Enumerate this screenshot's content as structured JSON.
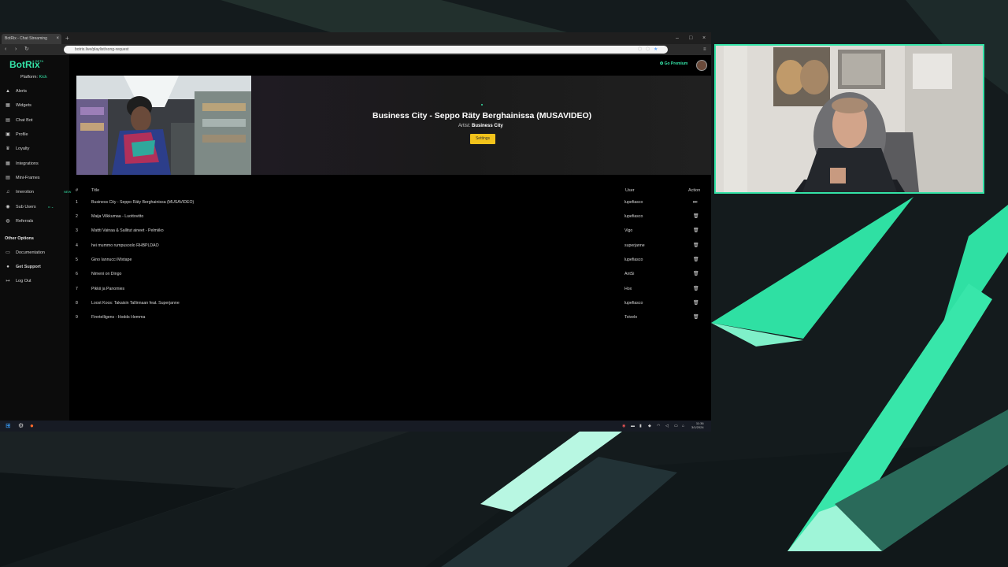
{
  "browser": {
    "tab_title": "BotRix - Chat Streaming",
    "tab_close": "×",
    "new_tab": "+",
    "url": "botrix.live/playlist/song-request",
    "window_controls": [
      "–",
      "□",
      "×"
    ]
  },
  "app": {
    "logo": "BotRix",
    "beta": "BETA",
    "platform_label": "Platform:",
    "platform_value": "Kick",
    "go_premium": "Go Premium",
    "nav": [
      {
        "icon": "bell-icon",
        "glyph": "▲",
        "label": "Alerts"
      },
      {
        "icon": "widgets-icon",
        "glyph": "▦",
        "label": "Widgets"
      },
      {
        "icon": "chat-icon",
        "glyph": "▤",
        "label": "Chat Bot"
      },
      {
        "icon": "profile-icon",
        "glyph": "▣",
        "label": "Profile"
      },
      {
        "icon": "trophy-icon",
        "glyph": "♛",
        "label": "Loyalty"
      },
      {
        "icon": "integrations-icon",
        "glyph": "▦",
        "label": "Integrations"
      },
      {
        "icon": "frames-icon",
        "glyph": "▤",
        "label": "Mini-Frames"
      },
      {
        "icon": "music-icon",
        "glyph": "♫",
        "label": "Imerotion",
        "badge": "NEW"
      },
      {
        "icon": "subusers-icon",
        "glyph": "◉",
        "label": "Sub Users",
        "badge": "•• ⌄"
      },
      {
        "icon": "referrals-icon",
        "glyph": "◍",
        "label": "Referrals"
      }
    ],
    "other_options_title": "Other Options",
    "other": [
      {
        "icon": "docs-icon",
        "glyph": "▭",
        "label": "Documentation"
      },
      {
        "icon": "support-icon",
        "glyph": "●",
        "label": "Get Support"
      },
      {
        "icon": "logout-icon",
        "glyph": "↦",
        "label": "Log Out"
      }
    ],
    "now_playing": {
      "title": "Business City - Seppo Räty Berghainissa (MUSAVIDEO)",
      "artist_label": "Artist:",
      "artist": "Business City",
      "settings_button": "Settings"
    },
    "table": {
      "headers": {
        "num": "#",
        "title": "Title",
        "user": "User",
        "action": "Action"
      },
      "rows": [
        {
          "num": "1",
          "title": "Business City - Seppo Räty Berghainissa (MUSAVIDEO)",
          "user": "lupefiasco",
          "action": "skip"
        },
        {
          "num": "2",
          "title": "Maija Vilkkumaa - Luottovitto",
          "user": "lupefiasco",
          "action": "delete"
        },
        {
          "num": "3",
          "title": "Mattti Vainaa & Sallitut aineet - Pelmiiko",
          "user": "Vigo",
          "action": "delete"
        },
        {
          "num": "4",
          "title": "hei mummo rumpusoolo RHBPLDAO",
          "user": "superjanne",
          "action": "delete"
        },
        {
          "num": "5",
          "title": "Gino Iannucci Mixtape",
          "user": "lupefiasco",
          "action": "delete"
        },
        {
          "num": "6",
          "title": "Nimeni on Dingo",
          "user": "AntSi",
          "action": "delete"
        },
        {
          "num": "7",
          "title": "Pikkii ja Panomies",
          "user": "Hox",
          "action": "delete"
        },
        {
          "num": "8",
          "title": "Loost Koos: Takaisin Tallinnaan feat. Superjanne",
          "user": "lupefiasco",
          "action": "delete"
        },
        {
          "num": "9",
          "title": "Finntelligens - Hodds Hemma",
          "user": "Toivelo",
          "action": "delete"
        }
      ]
    }
  },
  "taskbar": {
    "clock_time": "11:36",
    "clock_date": "3/1/2024"
  },
  "colors": {
    "accent": "#34e3a7",
    "settings_button": "#f2c31b"
  }
}
